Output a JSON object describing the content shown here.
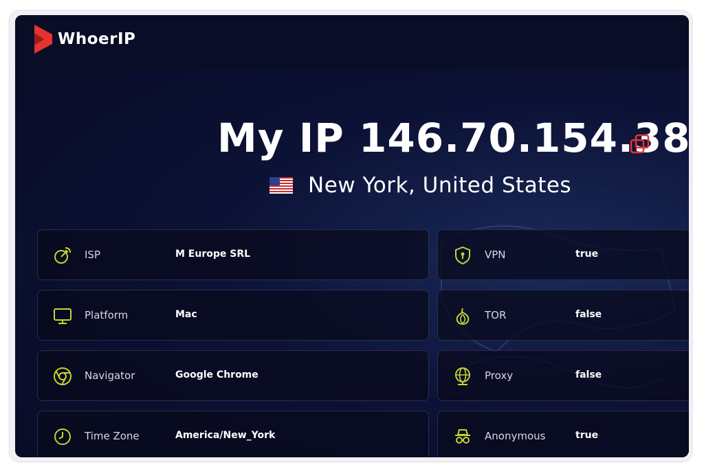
{
  "brand": {
    "name": "WhoerIP",
    "accent": "#e8322f"
  },
  "hero": {
    "ip_label": "My IP 146.70.154.38",
    "location": "New York, United States",
    "flag": "us-flag"
  },
  "info_left": [
    {
      "label": "ISP",
      "value": "M Europe SRL",
      "icon": "satellite-dish-icon"
    },
    {
      "label": "Platform",
      "value": "Mac",
      "icon": "monitor-icon"
    },
    {
      "label": "Navigator",
      "value": "Google Chrome",
      "icon": "chrome-icon"
    },
    {
      "label": "Time Zone",
      "value": "America/New_York",
      "icon": "clock-icon"
    }
  ],
  "info_right": [
    {
      "label": "VPN",
      "value": "true",
      "icon": "shield-icon"
    },
    {
      "label": "TOR",
      "value": "false",
      "icon": "onion-icon"
    },
    {
      "label": "Proxy",
      "value": "false",
      "icon": "globe-icon"
    },
    {
      "label": "Anonymous",
      "value": "true",
      "icon": "spy-icon"
    }
  ],
  "colors": {
    "icon": "#c7d430",
    "card_border": "#2a2f48",
    "background": "#080b24"
  }
}
